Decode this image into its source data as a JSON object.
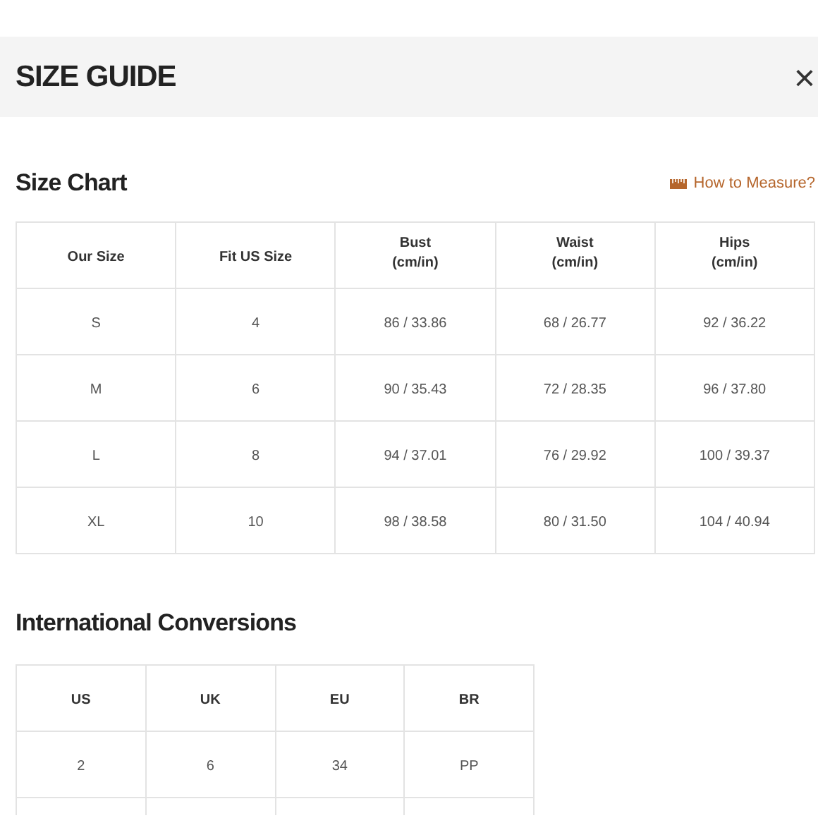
{
  "header": {
    "title": "SIZE GUIDE",
    "close": "×"
  },
  "size_chart": {
    "title": "Size Chart",
    "link": "How to Measure?",
    "columns": [
      "Our Size",
      "Fit US Size",
      "Bust\n(cm/in)",
      "Waist\n(cm/in)",
      "Hips\n(cm/in)"
    ],
    "rows": [
      [
        "S",
        "4",
        "86 / 33.86",
        "68 / 26.77",
        "92 / 36.22"
      ],
      [
        "M",
        "6",
        "90 / 35.43",
        "72 / 28.35",
        "96 / 37.80"
      ],
      [
        "L",
        "8",
        "94 / 37.01",
        "76 / 29.92",
        "100 / 39.37"
      ],
      [
        "XL",
        "10",
        "98 / 38.58",
        "80 / 31.50",
        "104 / 40.94"
      ]
    ]
  },
  "conversions": {
    "title": "International Conversions",
    "columns": [
      "US",
      "UK",
      "EU",
      "BR"
    ],
    "rows": [
      [
        "2",
        "6",
        "34",
        "PP"
      ]
    ]
  }
}
